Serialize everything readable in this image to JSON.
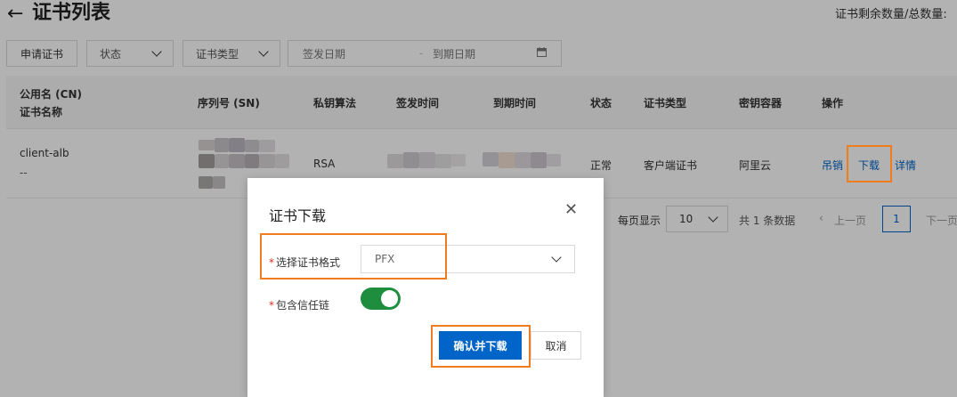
{
  "header": {
    "back_icon": "arrow-left-icon",
    "title": "证书列表",
    "quota_label": "证书剩余数量/总数量:"
  },
  "filters": {
    "apply_button": "申请证书",
    "status_select": "状态",
    "type_select": "证书类型",
    "issue_date": "签发日期",
    "expire_date": "到期日期",
    "date_separator": "-",
    "calendar_icon": "calendar-icon"
  },
  "table": {
    "headers": {
      "cn": "公用名 (CN)",
      "cert_name": "证书名称",
      "serial": "序列号 (SN)",
      "key_alg": "私钥算法",
      "issue_time": "签发时间",
      "expire_time": "到期时间",
      "status": "状态",
      "cert_type": "证书类型",
      "key_store": "密钥容器",
      "actions": "操作"
    },
    "rows": [
      {
        "cn": "client-alb",
        "cert_name": "--",
        "key_alg": "RSA",
        "status": "正常",
        "cert_type": "客户端证书",
        "key_store": "阿里云",
        "action_revoke": "吊销",
        "action_download": "下载",
        "action_detail": "详情"
      }
    ]
  },
  "pagination": {
    "per_page_label": "每页显示",
    "page_size": "10",
    "total_text": "共 1 条数据",
    "prev": "上一页",
    "current_page": "1",
    "next": "下一页"
  },
  "dialog": {
    "title": "证书下载",
    "close_icon": "close-icon",
    "format_label": "选择证书格式",
    "format_value": "PFX",
    "chain_label": "包含信任链",
    "chain_enabled": true,
    "required_mark": "*",
    "confirm": "确认并下载",
    "cancel": "取消"
  },
  "colors": {
    "primary": "#0064c8",
    "highlight": "#f07c1e",
    "toggle_on": "#1e8e3e",
    "required": "#d93026"
  }
}
